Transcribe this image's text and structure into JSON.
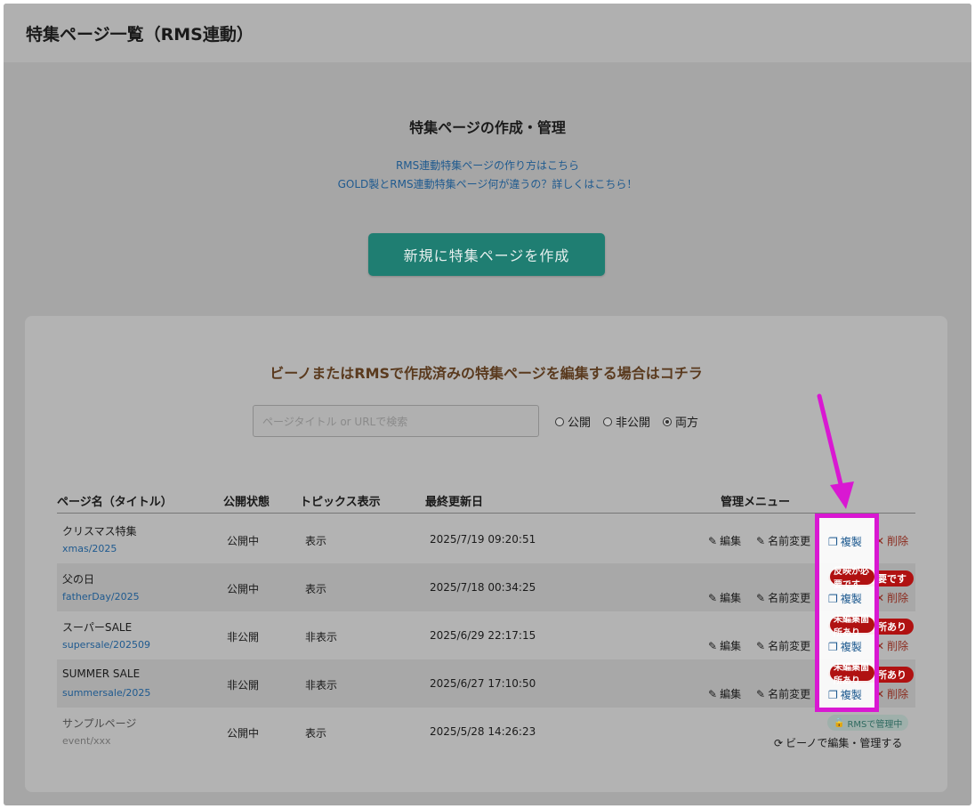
{
  "header": {
    "title": "特集ページ一覧（RMS連動）"
  },
  "intro": {
    "title": "特集ページの作成・管理",
    "link1": "RMS連動特集ページの作り方はこちら",
    "link2": "GOLD製とRMS連動特集ページ何が違うの？詳しくはこちら！",
    "create_button": "新規に特集ページを作成"
  },
  "card": {
    "title": "ビーノまたはRMSで作成済みの特集ページを編集する場合はコチラ",
    "search_placeholder": "ページタイトル or URLで検索",
    "filters": [
      "公開",
      "非公開",
      "両方"
    ],
    "selected_filter": "両方"
  },
  "table": {
    "headers": [
      "ページ名（タイトル）",
      "公開状態",
      "トピックス表示",
      "最終更新日",
      "管理メニュー"
    ],
    "rows": [
      {
        "name": "クリスマス特集",
        "slug": "xmas/2025",
        "status": "公開中",
        "topic": "表示",
        "date": "2025/7/19 09:20:51",
        "badge": ""
      },
      {
        "name": "父の日",
        "slug": "fatherDay/2025",
        "status": "公開中",
        "topic": "表示",
        "date": "2025/7/18 00:34:25",
        "badge": "反映が必要です"
      },
      {
        "name": "スーパーSALE",
        "slug": "supersale/202509",
        "status": "非公開",
        "topic": "非表示",
        "date": "2025/6/29 22:17:15",
        "badge": "未編集箇所あり"
      },
      {
        "name": "SUMMER SALE",
        "slug": "summersale/2025",
        "status": "非公開",
        "topic": "非表示",
        "date": "2025/6/27 17:10:50",
        "badge": "未編集箇所あり"
      },
      {
        "name": "サンプルページ",
        "slug": "event/xxx",
        "status": "公開中",
        "topic": "表示",
        "date": "2025/5/28 14:26:23",
        "badge": ""
      }
    ],
    "actions": {
      "edit": "編集",
      "rename": "名前変更",
      "copy": "複製",
      "delete": "削除"
    },
    "rms_badge": "RMSで管理中",
    "bino_link": "ビーノで編集・管理する"
  },
  "colors": {
    "accent": "#1f7e72",
    "link": "#1f5a8f",
    "badge": "#b01111",
    "highlight": "#d918d2"
  }
}
